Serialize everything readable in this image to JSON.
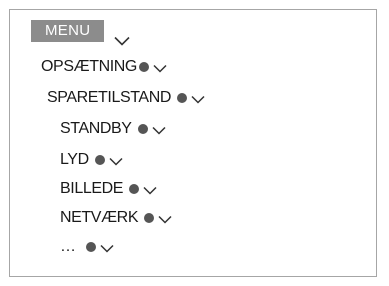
{
  "menu": {
    "label": "MENU"
  },
  "tree": [
    {
      "label": "OPSÆTNING",
      "level": 0
    },
    {
      "label": "SPARETILSTAND",
      "level": 1
    },
    {
      "label": "STANDBY",
      "level": 2
    },
    {
      "label": "LYD",
      "level": 2
    },
    {
      "label": "BILLEDE",
      "level": 2
    },
    {
      "label": "NETVÆRK",
      "level": 2
    },
    {
      "label": "…",
      "level": 2
    }
  ],
  "icons": {
    "dot": "filled-circle-bullet-icon",
    "chevron": "chevron-down-icon"
  },
  "colors": {
    "menu_background": "#8c8c8c",
    "menu_text": "#ffffff",
    "text": "#1a1a1a",
    "dot": "#555555",
    "border": "#a6a6a6"
  }
}
